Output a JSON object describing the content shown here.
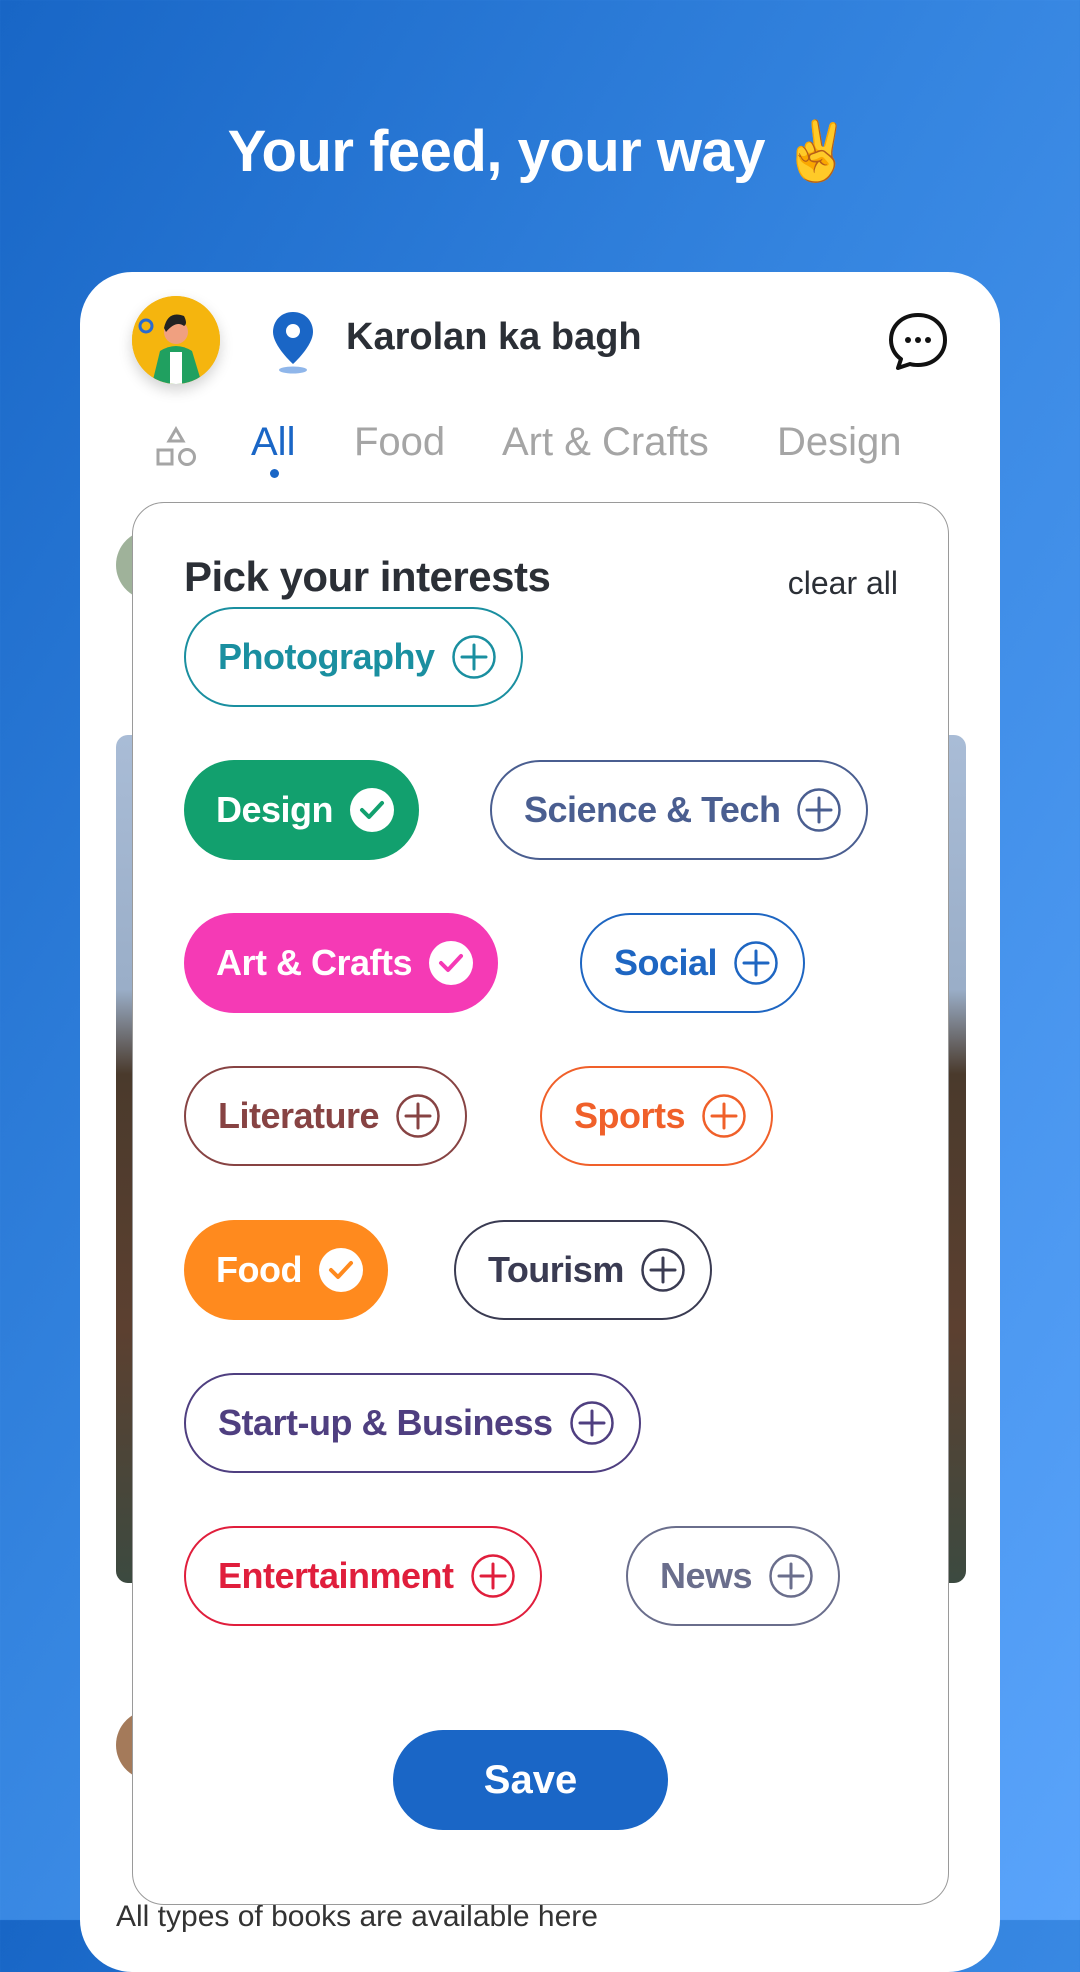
{
  "headline": "Your feed, your way ✌️",
  "header": {
    "location": "Karolan ka bagh"
  },
  "tabs": [
    {
      "label": "All",
      "active": true
    },
    {
      "label": "Food"
    },
    {
      "label": "Art & Crafts"
    },
    {
      "label": "Design"
    }
  ],
  "feed": {
    "text_snippet": "All types of books are available here"
  },
  "interests": {
    "title": "Pick your interests",
    "clear_all": "clear all",
    "chips": [
      {
        "label": "Photography",
        "selected": false,
        "color": "#1a8fa0"
      },
      {
        "label": "Design",
        "selected": true,
        "color": "#12a06e"
      },
      {
        "label": "Science & Tech",
        "selected": false,
        "color": "#4a5e90"
      },
      {
        "label": "Art & Crafts",
        "selected": true,
        "color": "#f53ab5"
      },
      {
        "label": "Social",
        "selected": false,
        "color": "#1e66c2"
      },
      {
        "label": "Literature",
        "selected": false,
        "color": "#874343"
      },
      {
        "label": "Sports",
        "selected": false,
        "color": "#f0602a"
      },
      {
        "label": "Food",
        "selected": true,
        "color": "#ff8a1e"
      },
      {
        "label": "Tourism",
        "selected": false,
        "color": "#3a3b52"
      },
      {
        "label": "Start-up & Business",
        "selected": false,
        "color": "#4f3f80"
      },
      {
        "label": "Entertainment",
        "selected": false,
        "color": "#e01e3c"
      },
      {
        "label": "News",
        "selected": false,
        "color": "#6a6e8c"
      }
    ],
    "save_label": "Save"
  },
  "colors": {
    "primary": "#1a66c6"
  }
}
